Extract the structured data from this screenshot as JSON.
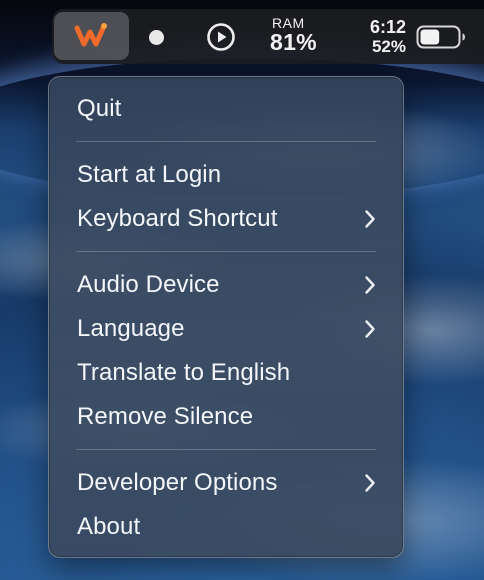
{
  "menubar": {
    "app_icon": "app-logo-icon",
    "status_dot_icon": "record-dot-icon",
    "play_icon": "play-circle-icon",
    "ram_label": "RAM",
    "ram_value": "81%",
    "time": "6:12",
    "battery_percent": "52%",
    "battery_level": 0.52,
    "battery_icon": "battery-icon",
    "accent_color": "#f06a2a"
  },
  "menu": {
    "items": [
      {
        "label": "Quit",
        "has_submenu": false
      },
      {
        "label": "Start at Login",
        "has_submenu": false
      },
      {
        "label": "Keyboard Shortcut",
        "has_submenu": true
      },
      {
        "label": "Audio Device",
        "has_submenu": true
      },
      {
        "label": "Language",
        "has_submenu": true
      },
      {
        "label": "Translate to English",
        "has_submenu": false
      },
      {
        "label": "Remove Silence",
        "has_submenu": false
      },
      {
        "label": "Developer Options",
        "has_submenu": true
      },
      {
        "label": "About",
        "has_submenu": false
      }
    ],
    "submenu_icon": "chevron-right-icon"
  }
}
